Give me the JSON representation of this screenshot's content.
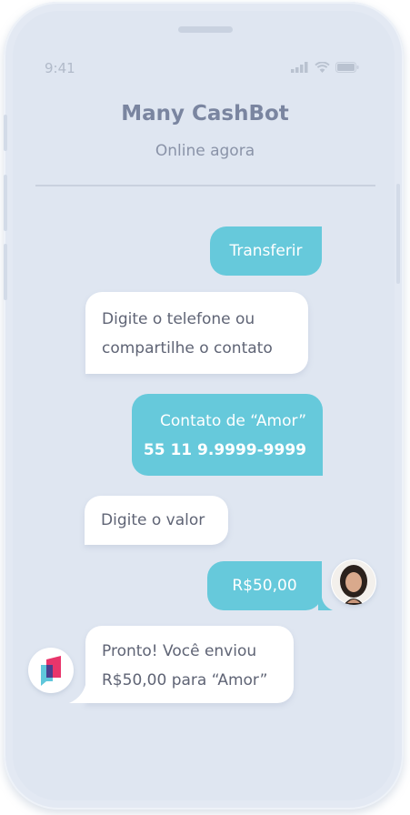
{
  "status_bar": {
    "time": "9:41"
  },
  "header": {
    "title": "Many CashBot",
    "subtitle": "Online agora"
  },
  "messages": [
    {
      "from": "user",
      "text": "Transferir"
    },
    {
      "from": "bot",
      "lines": [
        "Digite o telefone ou",
        "compartilhe o contato"
      ]
    },
    {
      "from": "user",
      "lines": [
        "Contato de “Amor”",
        "55 11 9.9999-9999"
      ]
    },
    {
      "from": "bot",
      "text": "Digite o valor"
    },
    {
      "from": "user",
      "text": "R$50,00"
    },
    {
      "from": "bot",
      "lines": [
        "Pronto! Você enviou",
        "R$50,00 para “Amor”"
      ]
    }
  ],
  "colors": {
    "user_bubble": "#66c9db",
    "bot_bubble": "#ffffff",
    "screen": "#dfe6f1",
    "title": "#7a85a0"
  },
  "icons": {
    "signal": "signal-icon",
    "wifi": "wifi-icon",
    "battery": "battery-icon",
    "bot_logo": "bot-logo-icon",
    "user_avatar": "user-avatar"
  }
}
